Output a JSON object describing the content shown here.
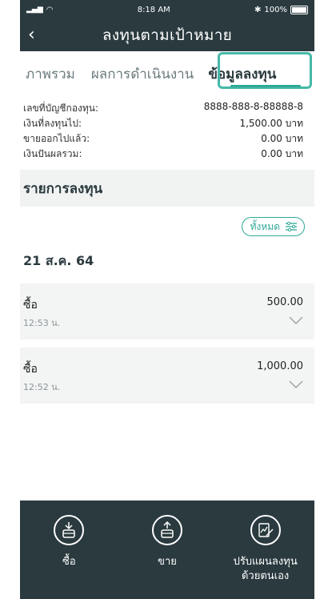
{
  "status": {
    "time": "8:18 AM",
    "battery": "100%"
  },
  "header": {
    "title": "ลงทุนตามเป้าหมาย"
  },
  "tabs": [
    {
      "label": "ภาพรวม"
    },
    {
      "label": "ผลการดำเนินงาน"
    },
    {
      "label": "ข้อมูลลงทุน",
      "active": true
    }
  ],
  "info": [
    {
      "label": "เลขที่บัญชีกองทุน:",
      "value": "8888-888-8-88888-8"
    },
    {
      "label": "เงินที่ลงทุนไป:",
      "value": "1,500.00 บาท"
    },
    {
      "label": "ขายออกไปแล้ว:",
      "value": "0.00 บาท"
    },
    {
      "label": "เงินปันผลรวม:",
      "value": "0.00 บาท"
    }
  ],
  "section": {
    "title": "รายการลงทุน"
  },
  "filter": {
    "label": "ทั้งหมด"
  },
  "date_group": "21 ส.ค. 64",
  "transactions": [
    {
      "type": "ซื้อ",
      "time": "12:53 น.",
      "amount": "500.00"
    },
    {
      "type": "ซื้อ",
      "time": "12:52 น.",
      "amount": "1,000.00"
    }
  ],
  "actions": [
    {
      "label": "ซื้อ",
      "icon": "buy-icon"
    },
    {
      "label": "ขาย",
      "icon": "sell-icon"
    },
    {
      "label": "ปรับแผนลงทุน\nด้วยตนเอง",
      "icon": "adjust-plan-icon"
    }
  ],
  "colors": {
    "header": "#2a3a3f",
    "accent": "#2fa998",
    "highlight": "#46b8a8"
  }
}
